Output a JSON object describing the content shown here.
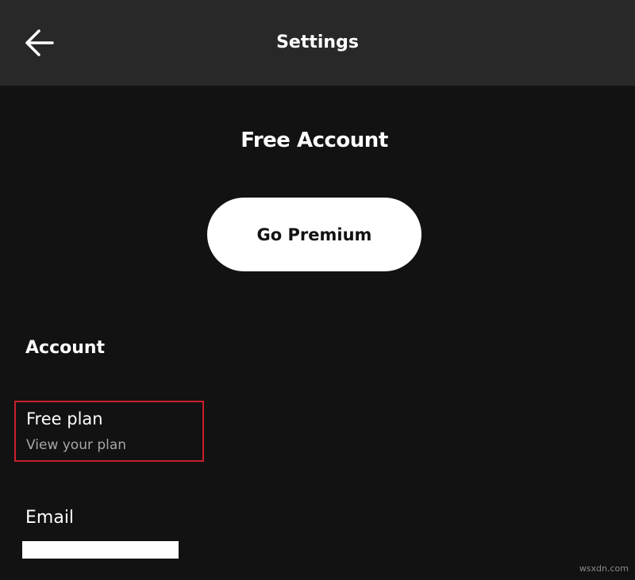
{
  "header": {
    "title": "Settings",
    "back_icon": "arrow-left-icon"
  },
  "account": {
    "type_label": "Free Account",
    "premium_button_label": "Go Premium"
  },
  "section": {
    "heading": "Account"
  },
  "plan_item": {
    "title": "Free plan",
    "subtitle": "View your plan"
  },
  "email": {
    "label": "Email",
    "value": ""
  },
  "watermark": {
    "text": "wsxdn.com"
  },
  "colors": {
    "background": "#121212",
    "header_background": "#282828",
    "highlight_border": "#c8202a",
    "subtitle_text": "#a7a7a7"
  }
}
